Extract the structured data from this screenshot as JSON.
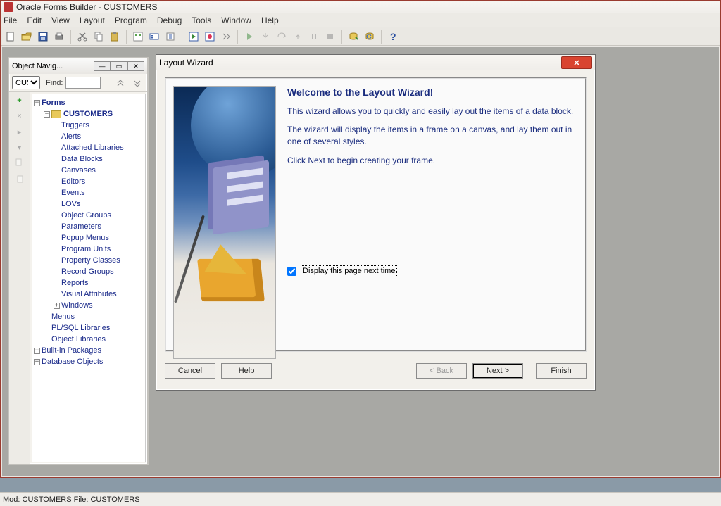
{
  "title": "Oracle Forms Builder - CUSTOMERS",
  "menu": [
    "File",
    "Edit",
    "View",
    "Layout",
    "Program",
    "Debug",
    "Tools",
    "Window",
    "Help"
  ],
  "navigator": {
    "title": "Object Navig...",
    "selector_value": "CUS",
    "find_label": "Find:",
    "find_value": "",
    "tree": {
      "root": "Forms",
      "module": "CUSTOMERS",
      "children": [
        "Triggers",
        "Alerts",
        "Attached Libraries",
        "Data Blocks",
        "Canvases",
        "Editors",
        "Events",
        "LOVs",
        "Object Groups",
        "Parameters",
        "Popup Menus",
        "Program Units",
        "Property Classes",
        "Record Groups",
        "Reports",
        "Visual Attributes"
      ],
      "windows": "Windows",
      "siblings": [
        "Menus",
        "PL/SQL Libraries",
        "Object Libraries"
      ],
      "builtins": "Built-in Packages",
      "dbobjects": "Database Objects"
    },
    "side_icons": [
      "plus",
      "x",
      "up",
      "down",
      "copy",
      "copy2"
    ]
  },
  "wizard": {
    "title": "Layout Wizard",
    "heading": "Welcome to the Layout Wizard!",
    "para1": "This wizard allows you to quickly and easily lay out the items of a data block.",
    "para2": "The wizard will display the items in a frame on a canvas, and lay them out in one of several styles.",
    "para3": "Click Next to begin creating your frame.",
    "checkbox_label": "Display this page next time",
    "checkbox_checked": true,
    "buttons": {
      "cancel": "Cancel",
      "help": "Help",
      "back": "< Back",
      "next": "Next >",
      "finish": "Finish"
    }
  },
  "status": "Mod: CUSTOMERS File: CUSTOMERS"
}
